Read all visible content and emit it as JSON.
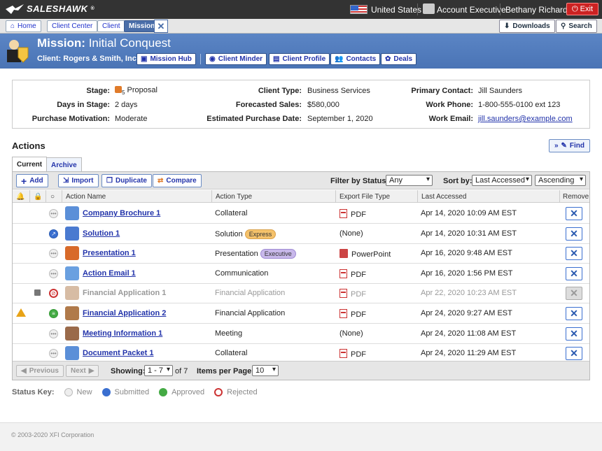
{
  "app": {
    "brand": "SalesHawk",
    "reg": "®"
  },
  "topbar": {
    "country": "United States",
    "role": "Account Executive",
    "user": "Bethany Richards",
    "exit": "Exit"
  },
  "nav": {
    "breadcrumbs": [
      "Home",
      "Client Center",
      "Client",
      "Mission"
    ],
    "close": "✕",
    "downloads": "Downloads",
    "search": "Search"
  },
  "header": {
    "label": "Mission:",
    "mission": "Initial Conquest",
    "client_label": "Client:",
    "client": "Rogers & Smith, Inc.",
    "buttons": [
      "Mission Hub",
      "Client Minder",
      "Client Profile",
      "Contacts",
      "Deals"
    ]
  },
  "info": {
    "stage_label": "Stage:",
    "stage_num": "5",
    "stage": "Proposal",
    "days_label": "Days in Stage:",
    "days": "2 days",
    "motivation_label": "Purchase Motivation:",
    "motivation": "Moderate",
    "client_type_label": "Client Type:",
    "client_type": "Business Services",
    "forecast_label": "Forecasted Sales:",
    "forecast": "$580,000",
    "est_date_label": "Estimated Purchase Date:",
    "est_date": "September 1, 2020",
    "contact_label": "Primary Contact:",
    "contact": "Jill Saunders",
    "phone_label": "Work Phone:",
    "phone": "1-800-555-0100 ext 123",
    "email_label": "Work Email:",
    "email": "jill.saunders@example.com"
  },
  "actions": {
    "title": "Actions",
    "find": "Find",
    "tabs": [
      "Current",
      "Archive"
    ],
    "toolbar": {
      "add": "Add",
      "import": "Import",
      "duplicate": "Duplicate",
      "compare": "Compare",
      "filter_label": "Filter by Status:",
      "filter_value": "Any",
      "sort_label": "Sort by:",
      "sort_value": "Last Accessed",
      "order_value": "Ascending"
    },
    "columns": [
      "Action Name",
      "Action Type",
      "Export File Type",
      "Last Accessed",
      "Remove"
    ],
    "rows": [
      {
        "name": "Company Brochure 1",
        "type": "Collateral",
        "badge": "",
        "export": "PDF",
        "accessed": "Apr 14, 2020 10:09 AM EST",
        "status": "new",
        "disabled": false,
        "warn": false,
        "lock": false
      },
      {
        "name": "Solution 1",
        "type": "Solution",
        "badge": "Express",
        "export": "(None)",
        "accessed": "Apr 14, 2020 10:31 AM EST",
        "status": "submitted",
        "disabled": false,
        "warn": false,
        "lock": false
      },
      {
        "name": "Presentation 1",
        "type": "Presentation",
        "badge": "Executive",
        "export": "PowerPoint",
        "accessed": "Apr 16, 2020 9:48 AM EST",
        "status": "new",
        "disabled": false,
        "warn": false,
        "lock": false
      },
      {
        "name": "Action Email 1",
        "type": "Communication",
        "badge": "",
        "export": "PDF",
        "accessed": "Apr 16, 2020 1:56 PM EST",
        "status": "new",
        "disabled": false,
        "warn": false,
        "lock": false
      },
      {
        "name": "Financial Application 1",
        "type": "Financial Application",
        "badge": "",
        "export": "PDF",
        "accessed": "Apr 22, 2020 10:23 AM EST",
        "status": "rejected",
        "disabled": true,
        "warn": false,
        "lock": true
      },
      {
        "name": "Financial Application 2",
        "type": "Financial Application",
        "badge": "",
        "export": "PDF",
        "accessed": "Apr 24, 2020 9:27 AM EST",
        "status": "approved",
        "disabled": false,
        "warn": true,
        "lock": false
      },
      {
        "name": "Meeting Information 1",
        "type": "Meeting",
        "badge": "",
        "export": "(None)",
        "accessed": "Apr 24, 2020 11:08 AM EST",
        "status": "new",
        "disabled": false,
        "warn": false,
        "lock": false
      },
      {
        "name": "Document Packet 1",
        "type": "Collateral",
        "badge": "",
        "export": "PDF",
        "accessed": "Apr 24, 2020 11:29 AM EST",
        "status": "new",
        "disabled": false,
        "warn": false,
        "lock": false
      }
    ],
    "pager": {
      "prev": "Previous",
      "next": "Next",
      "showing_label": "Showing:",
      "showing_value": "1 - 7",
      "of": "of 7",
      "ipp_label": "Items per Page:",
      "ipp_value": "10"
    }
  },
  "status_key": {
    "label": "Status Key:",
    "items": [
      "New",
      "Submitted",
      "Approved",
      "Rejected"
    ]
  },
  "copyright": "© 2003-2020 XFI Corporation",
  "colors": {
    "accent": "#4a74b5",
    "link": "#2233aa",
    "exit": "#cc2222"
  }
}
